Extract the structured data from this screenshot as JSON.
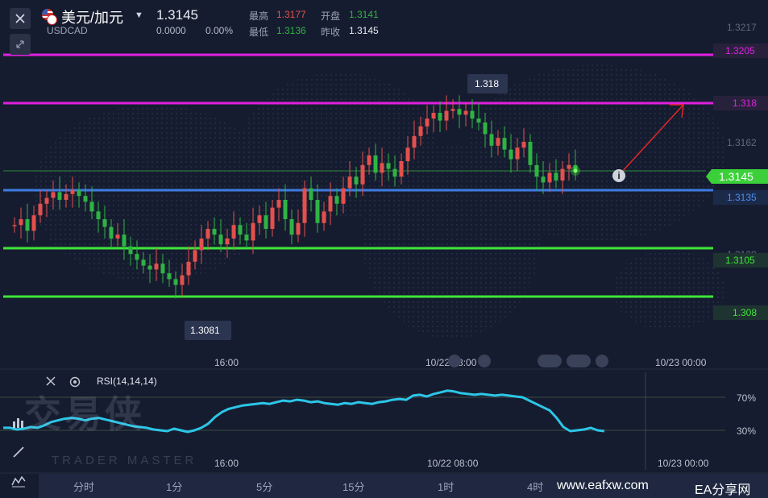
{
  "header": {
    "pair_cn": "美元/加元",
    "symbol": "USDCAD",
    "price": "1.3145",
    "change": "0.0000",
    "change_pct": "0.00%",
    "high_label": "最高",
    "high": "1.3177",
    "open_label": "开盘",
    "open": "1.3141",
    "low_label": "最低",
    "low": "1.3136",
    "prev_label": "昨收",
    "prev": "1.3145"
  },
  "price_axis": {
    "ticks": [
      "1.3217",
      "1.3162",
      "1.3108"
    ],
    "level_labels": {
      "magenta_top": "1.3205",
      "magenta_mid": "1.318",
      "current": "1.3145",
      "blue": "1.3135",
      "green_upper": "1.3105",
      "green_lower": "1.308"
    }
  },
  "callouts": {
    "high_point": "1.318",
    "low_point": "1.3081"
  },
  "time_axis": {
    "labels": [
      "16:00",
      "10/22 08:00",
      "10/23 00:00"
    ]
  },
  "rsi": {
    "title": "RSI(14,14,14)",
    "levels": [
      "70%",
      "30%"
    ],
    "time_labels": [
      "16:00",
      "10/22 08:00",
      "10/23 00:00"
    ]
  },
  "watermark": {
    "cn": "交易侠",
    "en": "TRADER MASTER"
  },
  "timeframes": [
    "分时",
    "1分",
    "5分",
    "15分",
    "1时",
    "4时"
  ],
  "footer": {
    "site": "www.eafxw.com",
    "brand": "EA分享网"
  },
  "colors": {
    "background": "#161c2f",
    "up": "#e4504d",
    "down": "#2fb343",
    "magenta": "#e020e0",
    "blue": "#3d7be0",
    "green": "#3ee63a",
    "rsi_line": "#2cc6e8"
  },
  "icons": [
    "close-icon",
    "collapse-arrows-icon",
    "us-flag-icon",
    "dropdown-icon",
    "info-icon",
    "settings-icon",
    "chart-bars-icon",
    "draw-line-icon",
    "indicator-wave-icon"
  ]
}
